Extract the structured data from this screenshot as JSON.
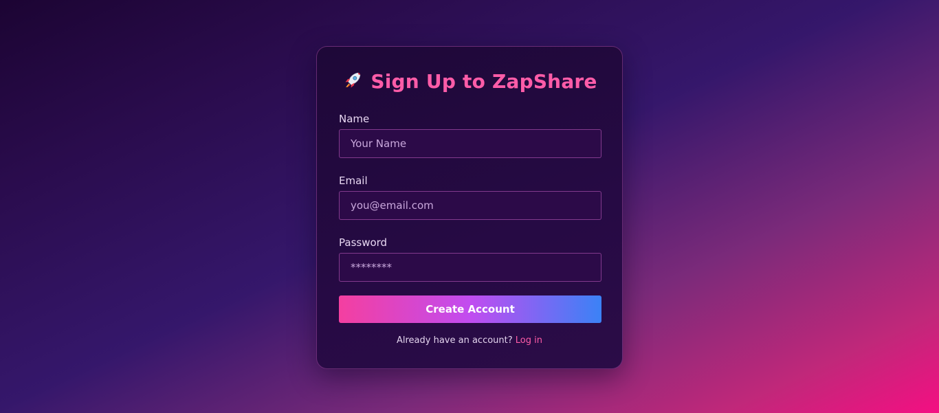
{
  "signup": {
    "title": "Sign Up to ZapShare",
    "title_icon": "rocket-icon",
    "fields": {
      "name": {
        "label": "Name",
        "placeholder": "Your Name",
        "value": ""
      },
      "email": {
        "label": "Email",
        "placeholder": "you@email.com",
        "value": ""
      },
      "password": {
        "label": "Password",
        "placeholder": "********",
        "value": ""
      }
    },
    "submit_label": "Create Account",
    "footer": {
      "prompt": "Already have an account?",
      "link_label": "Log in"
    }
  },
  "colors": {
    "accent": "#ff5ca8",
    "button_gradient_start": "#f43fa0",
    "button_gradient_mid": "#c14cf0",
    "button_gradient_end": "#3b82f6",
    "card_background": "#1e0838",
    "input_background": "#2c0a48"
  }
}
